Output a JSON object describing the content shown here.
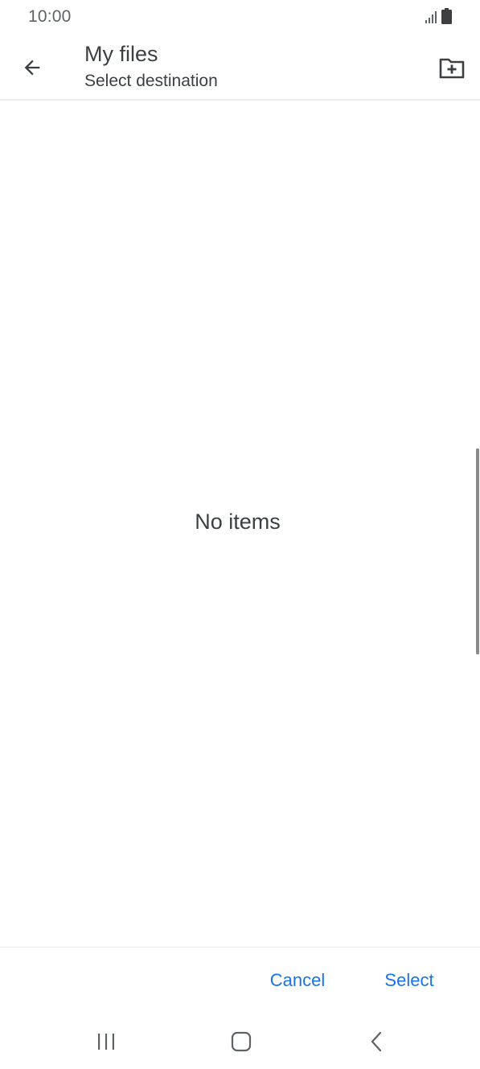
{
  "status_bar": {
    "time": "10:00",
    "icons": [
      "signal-icon",
      "battery-icon"
    ]
  },
  "app_bar": {
    "title": "My files",
    "subtitle": "Select destination",
    "back_icon": "arrow-left-icon",
    "new_folder_icon": "folder-plus-icon"
  },
  "content": {
    "empty_message": "No items"
  },
  "actions": {
    "cancel_label": "Cancel",
    "select_label": "Select"
  },
  "nav_bar": {
    "icons": [
      "recents-icon",
      "home-icon",
      "back-icon"
    ]
  },
  "colors": {
    "accent": "#1a73e8",
    "text": "#3c4043",
    "muted": "#5f6368",
    "background": "#ffffff"
  }
}
